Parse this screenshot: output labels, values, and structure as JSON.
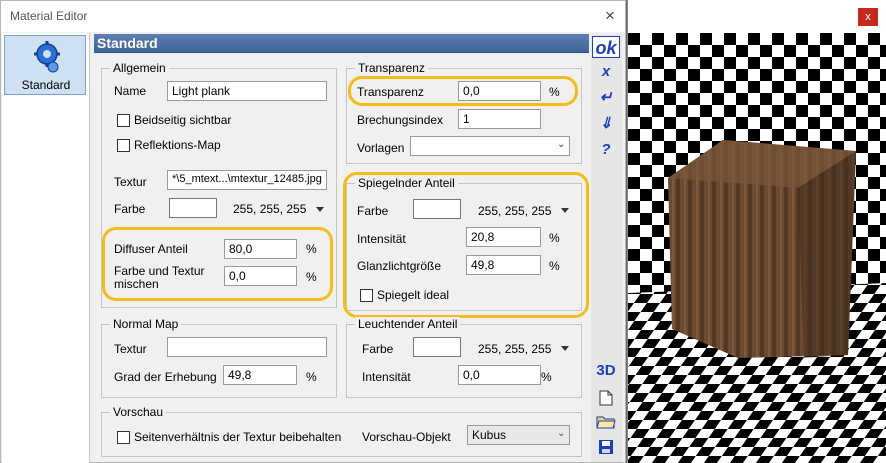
{
  "window": {
    "title": "Material Editor",
    "close_label": "×"
  },
  "nav": {
    "items": [
      {
        "label": "Standard"
      }
    ]
  },
  "header": {
    "title": "Standard"
  },
  "toolbar": {
    "ok_label": "ok",
    "cancel_label": "x",
    "apply_label": "↵",
    "pick_label": "⇓",
    "help_label": "?",
    "view3d_label": "3D"
  },
  "allgemein": {
    "title": "Allgemein",
    "name_label": "Name",
    "name_value": "Light plank",
    "double_sided_label": "Beidseitig sichtbar",
    "reflection_label": "Reflektions-Map",
    "texture_label": "Textur",
    "texture_value": "*\\5_mtext...\\mtextur_12485.jpg",
    "color_label": "Farbe",
    "color_value": "255, 255, 255",
    "diffuse_label": "Diffuser Anteil",
    "diffuse_value": "80,0",
    "diffuse_unit": "%",
    "mix_label": "Farbe und Textur mischen",
    "mix_value": "0,0",
    "mix_unit": "%"
  },
  "transparenz": {
    "title": "Transparenz",
    "transparency_label": "Transparenz",
    "transparency_value": "0,0",
    "transparency_unit": "%",
    "refraction_label": "Brechungsindex",
    "refraction_value": "1",
    "presets_label": "Vorlagen",
    "presets_value": ""
  },
  "spiegelnd": {
    "title": "Spiegelnder Anteil",
    "color_label": "Farbe",
    "color_value": "255, 255, 255",
    "intensity_label": "Intensität",
    "intensity_value": "20,8",
    "intensity_unit": "%",
    "gloss_label": "Glanzlichtgröße",
    "gloss_value": "49,8",
    "gloss_unit": "%",
    "ideal_label": "Spiegelt ideal"
  },
  "normalmap": {
    "title": "Normal Map",
    "texture_label": "Textur",
    "texture_value": "",
    "elevation_label": "Grad der Erhebung",
    "elevation_value": "49,8",
    "elevation_unit": "%"
  },
  "leuchtend": {
    "title": "Leuchtender Anteil",
    "color_label": "Farbe",
    "color_value": "255, 255, 255",
    "intensity_label": "Intensität",
    "intensity_value": "0,0",
    "intensity_unit": "%"
  },
  "vorschau": {
    "title": "Vorschau",
    "aspect_label": "Seitenverhältnis der Textur beibehalten",
    "object_label": "Vorschau-Objekt",
    "object_value": "Kubus"
  },
  "preview": {
    "close_label": "x"
  },
  "colors": {
    "highlight": "#f2bd16",
    "header": "#3f6399",
    "accent": "#1f3fb7"
  }
}
